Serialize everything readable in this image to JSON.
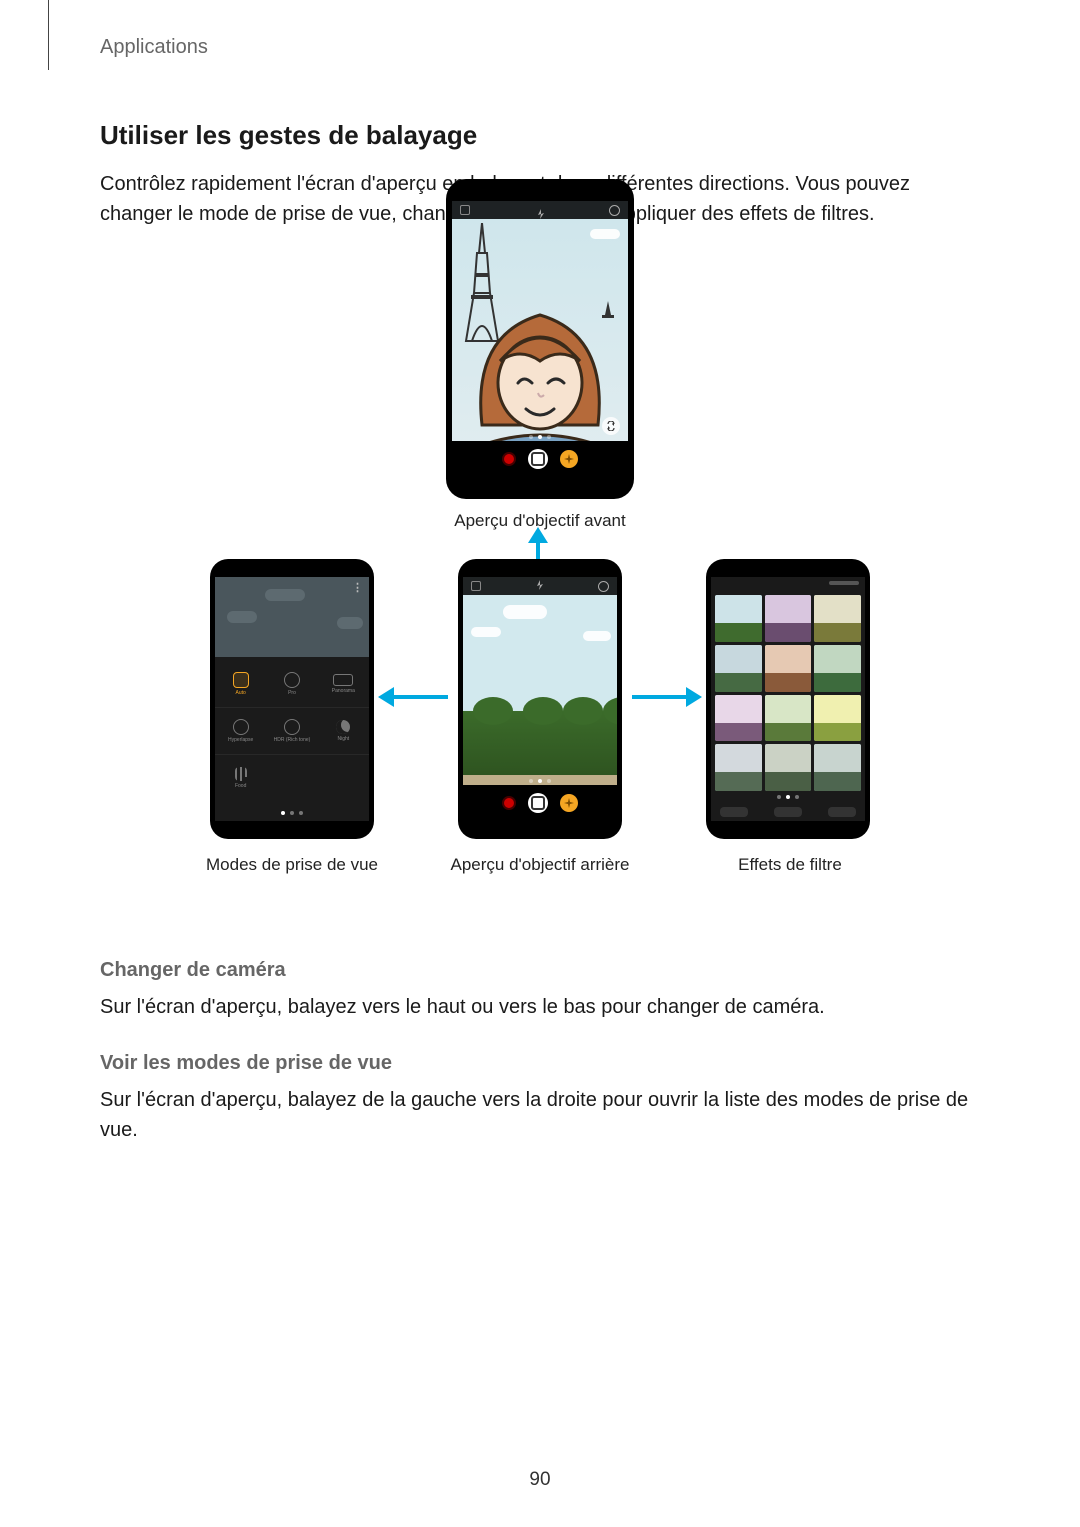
{
  "header": {
    "section": "Applications"
  },
  "title": "Utiliser les gestes de balayage",
  "intro": "Contrôlez rapidement l'écran d'aperçu en balayant dans différentes directions. Vous pouvez changer le mode de prise de vue, changer de caméra, ou appliquer des effets de filtres.",
  "captions": {
    "top": "Aperçu d'objectif avant",
    "left": "Modes de prise de vue",
    "center": "Aperçu d'objectif arrière",
    "right": "Effets de filtre"
  },
  "modes": {
    "row1": [
      "Auto",
      "Pro",
      "Panorama"
    ],
    "row2": [
      "Hyperlapse",
      "HDR (Rich tone)",
      "Night"
    ],
    "row3": [
      "Food",
      "",
      ""
    ]
  },
  "sections": {
    "s1_title": "Changer de caméra",
    "s1_body": "Sur l'écran d'aperçu, balayez vers le haut ou vers le bas pour changer de caméra.",
    "s2_title": "Voir les modes de prise de vue",
    "s2_body": "Sur l'écran d'aperçu, balayez de la gauche vers la droite pour ouvrir la liste des modes de prise de vue."
  },
  "colors": {
    "arrow": "#00a9e0",
    "accent_orange": "#f5a623"
  },
  "filter_tints": [
    {
      "sky": "#cde3e8",
      "tree": "#3f6b2e"
    },
    {
      "sky": "#d9c6df",
      "tree": "#6a4d6f"
    },
    {
      "sky": "#e3e0c7",
      "tree": "#7a7a3a"
    },
    {
      "sky": "#c7d8de",
      "tree": "#466a43"
    },
    {
      "sky": "#e6c9b3",
      "tree": "#8a5a3a"
    },
    {
      "sky": "#c1d7c1",
      "tree": "#3d6b3d"
    },
    {
      "sky": "#e8d7e8",
      "tree": "#7a5a7a"
    },
    {
      "sky": "#d8e6c6",
      "tree": "#5a7a3a"
    },
    {
      "sky": "#f0f0b0",
      "tree": "#8aa040"
    },
    {
      "sky": "#d3d9dd",
      "tree": "#556b55"
    },
    {
      "sky": "#cbd2c5",
      "tree": "#4a5f45"
    },
    {
      "sky": "#c8d4cf",
      "tree": "#4e6650"
    }
  ],
  "page_number": "90"
}
